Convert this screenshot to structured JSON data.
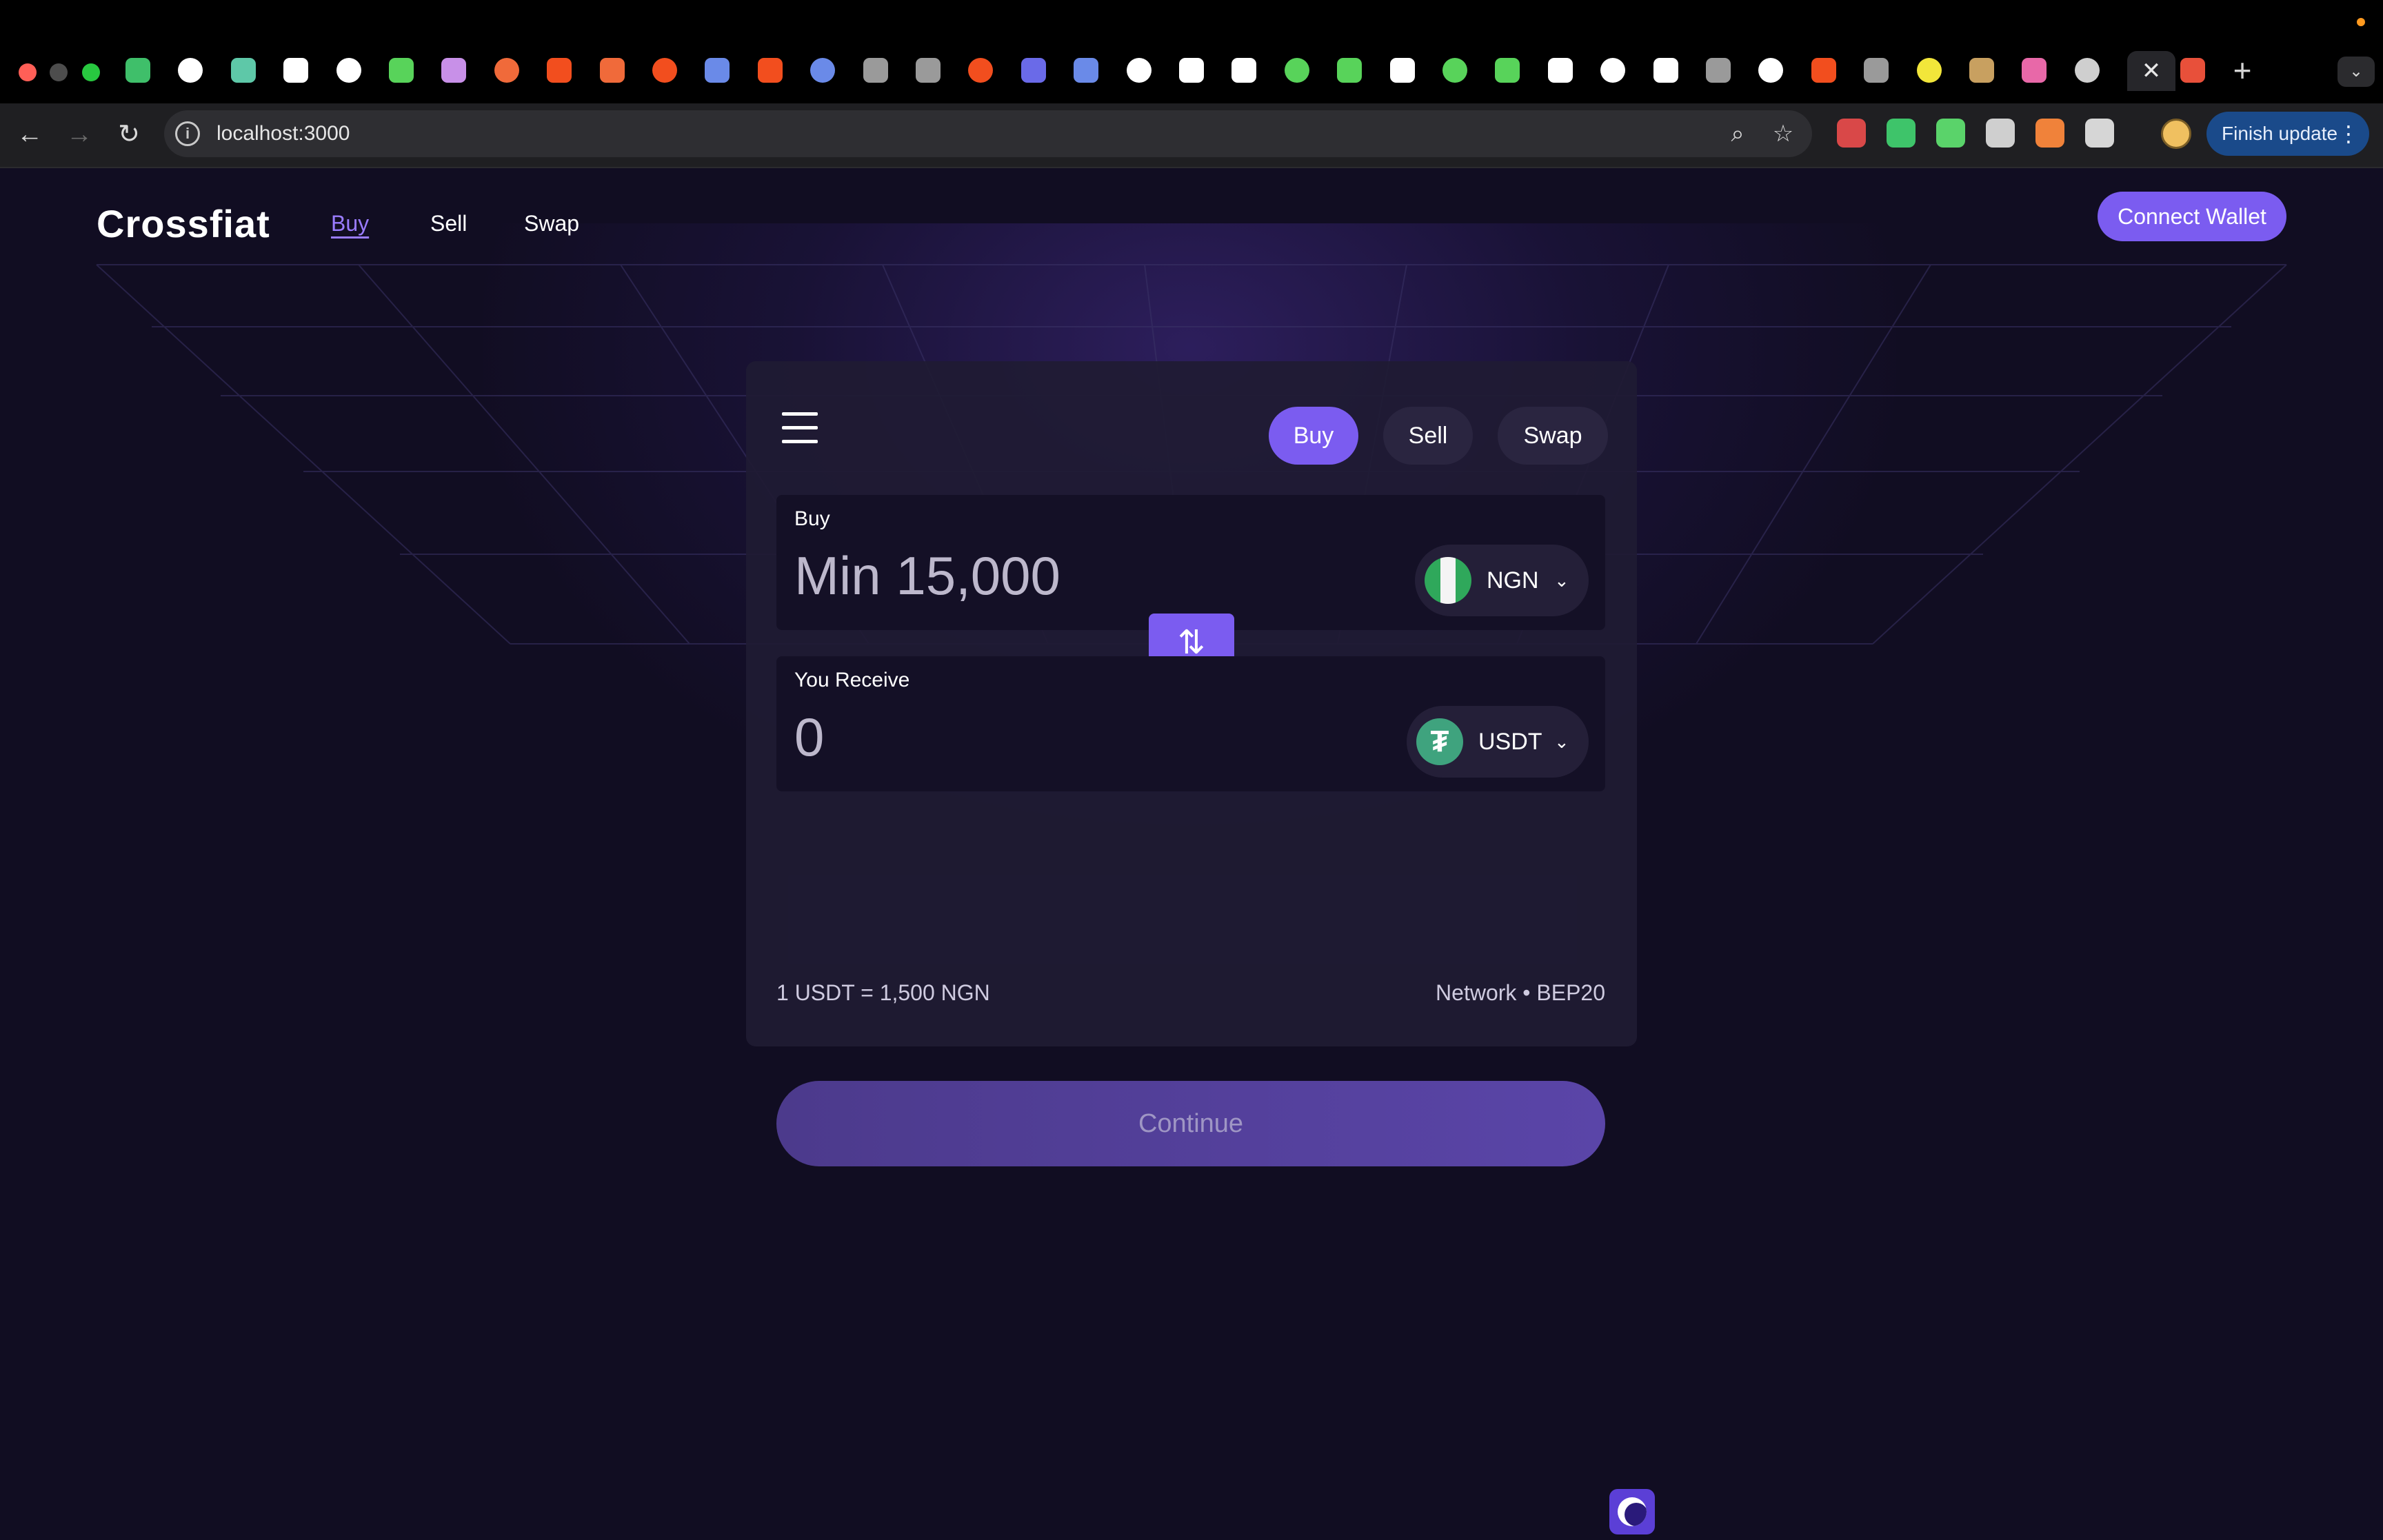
{
  "browser": {
    "url": "localhost:3000",
    "finish_update_label": "Finish update",
    "more_icon": "⋮",
    "tab_close_glyph": "✕",
    "new_tab_glyph": "+",
    "tab_overflow_glyph": "⌄",
    "nav": {
      "back": "←",
      "forward": "→",
      "reload": "↻"
    },
    "omnibox_icons": {
      "zoom": "⌕",
      "bookmark": "☆"
    },
    "tab_icon_colors": [
      "#3fbf6a",
      "#ffffff",
      "#5ec8a8",
      "#ffffff",
      "#ffffff",
      "#58d35a",
      "#c890e8",
      "#f06a3a",
      "#f24e1e",
      "#f06a3a",
      "#f24e1e",
      "#6a8ae8",
      "#f24e1e",
      "#6a8ae8",
      "#9a9a9a",
      "#9a9a9a",
      "#f24e1e",
      "#6a6ae8",
      "#6a8ae8",
      "#ffffff",
      "#ffffff",
      "#ffffff",
      "#58d35a",
      "#58d35a",
      "#ffffff",
      "#58d35a",
      "#58d35a",
      "#ffffff",
      "#ffffff",
      "#ffffff",
      "#9a9a9a",
      "#ffffff",
      "#f24e1e",
      "#9a9a9a",
      "#f2e63a",
      "#c8a060",
      "#e868a8",
      "#cfcfcf"
    ],
    "extensions": [
      {
        "icon": "grid-red-icon",
        "color": "#d94848"
      },
      {
        "icon": "ring-green-icon",
        "color": "#3ec46a"
      },
      {
        "icon": "chart-green-icon",
        "color": "#5ad36a"
      },
      {
        "icon": "vee-icon",
        "color": "#cfcfcf"
      },
      {
        "icon": "fox-icon",
        "color": "#f0823a"
      },
      {
        "icon": "puzzle-icon",
        "color": "#d6d6d6"
      }
    ]
  },
  "app": {
    "brand": "Crossfiat",
    "nav": [
      {
        "label": "Buy",
        "active": true
      },
      {
        "label": "Sell",
        "active": false
      },
      {
        "label": "Swap",
        "active": false
      }
    ],
    "connect_wallet": "Connect Wallet",
    "accent": "#7b5cf0"
  },
  "widget": {
    "tabs": [
      {
        "label": "Buy",
        "active": true
      },
      {
        "label": "Sell",
        "active": false
      },
      {
        "label": "Swap",
        "active": false
      }
    ],
    "pay": {
      "label": "Buy",
      "placeholder": "Min 15,000",
      "currency": "NGN",
      "currency_icon": "nigeria-flag-icon"
    },
    "swap_icon": "⇅",
    "receive": {
      "label": "You Receive",
      "value": "0",
      "currency": "USDT",
      "currency_icon": "tether-icon",
      "currency_glyph": "₮"
    },
    "chevron": "⌄",
    "rate": "1 USDT = 1,500 NGN",
    "network": "Network • BEP20",
    "continue": "Continue"
  }
}
